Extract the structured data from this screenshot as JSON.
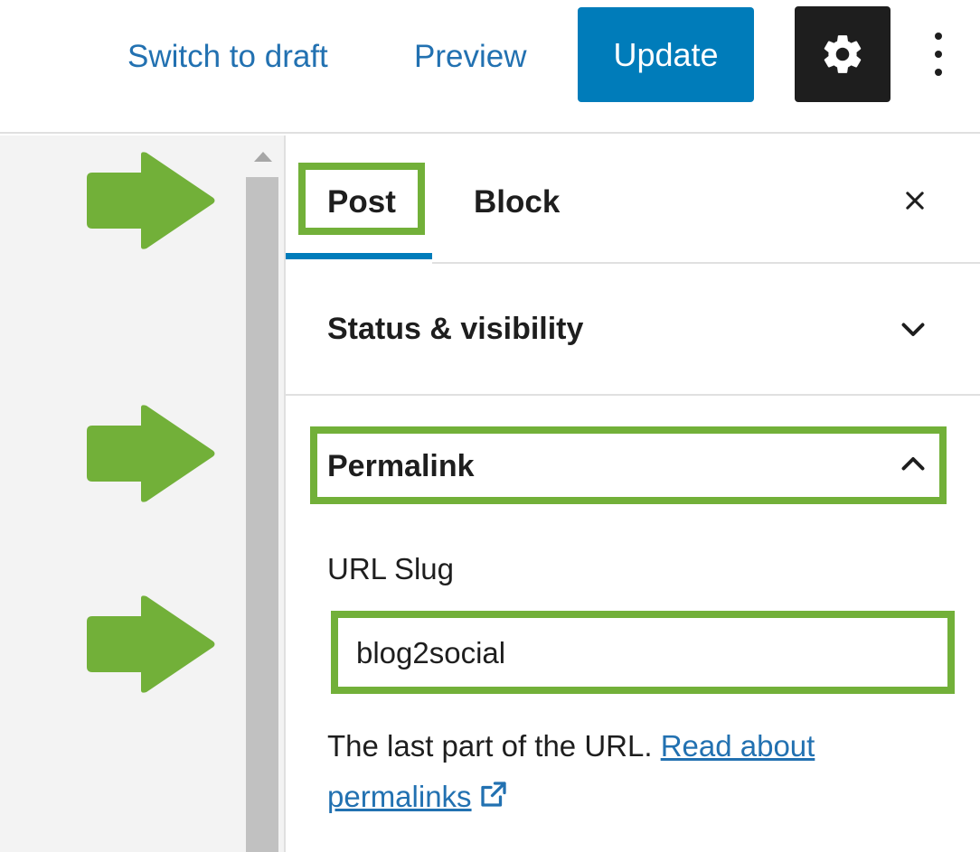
{
  "toolbar": {
    "switch_to_draft": "Switch to draft",
    "preview": "Preview",
    "update": "Update",
    "settings_icon": "gear-icon",
    "more_icon": "vertical-ellipsis-icon"
  },
  "sidebar": {
    "tabs": [
      {
        "label": "Post",
        "active": true
      },
      {
        "label": "Block",
        "active": false
      }
    ],
    "close_icon": "close-icon",
    "panels": {
      "status": {
        "title": "Status & visibility",
        "expanded": false
      },
      "permalink": {
        "title": "Permalink",
        "expanded": true,
        "url_slug_label": "URL Slug",
        "url_slug_value": "blog2social",
        "help_text": "The last part of the URL.",
        "help_link": "Read about permalinks"
      }
    }
  },
  "colors": {
    "accent": "#007cba",
    "link": "#2271b1",
    "highlight": "#72b039",
    "settings_bg": "#1e1e1e"
  }
}
